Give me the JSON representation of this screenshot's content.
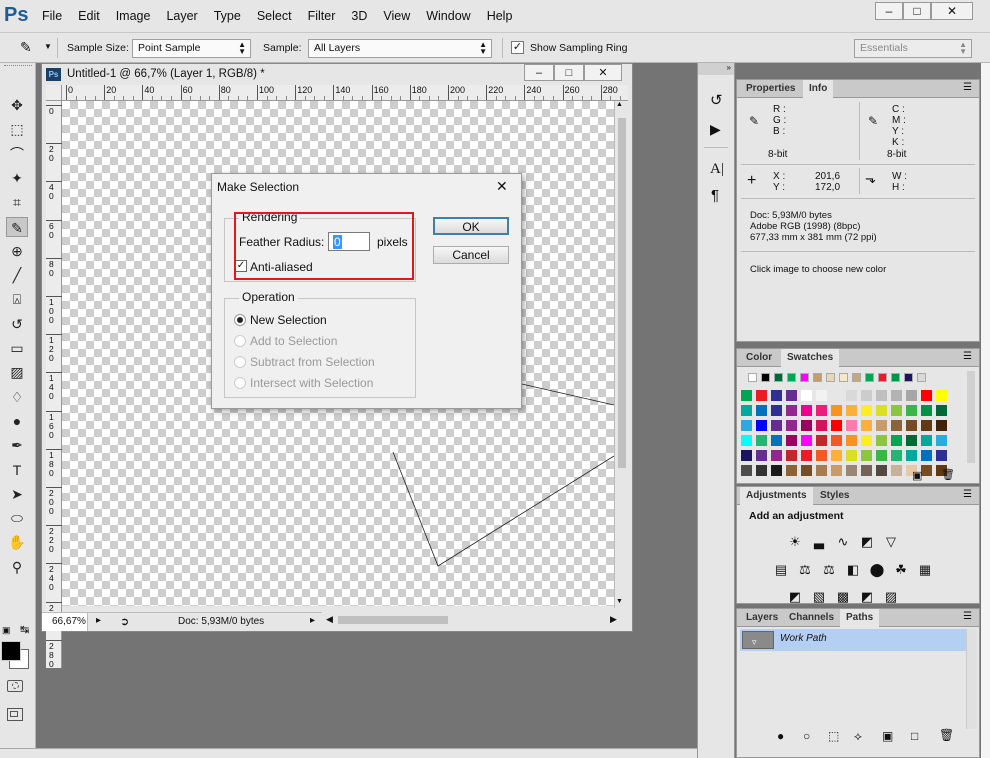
{
  "app": {
    "logo": "Ps",
    "menu": [
      "File",
      "Edit",
      "Image",
      "Layer",
      "Type",
      "Select",
      "Filter",
      "3D",
      "View",
      "Window",
      "Help"
    ],
    "window_controls": [
      "–",
      "□",
      "✕"
    ]
  },
  "options": {
    "sample_size_label": "Sample Size:",
    "sample_size_value": "Point Sample",
    "sample_label": "Sample:",
    "sample_value": "All Layers",
    "show_ring_label": "Show Sampling Ring",
    "show_ring_checked": true,
    "workspace": "Essentials"
  },
  "tools": [
    "move-icon",
    "marquee-icon",
    "lasso-icon",
    "quick-select-icon",
    "crop-icon",
    "eyedropper-icon",
    "healing-icon",
    "brush-icon",
    "stamp-icon",
    "history-brush-icon",
    "eraser-icon",
    "gradient-icon",
    "blur-icon",
    "dodge-icon",
    "pen-icon",
    "type-icon",
    "path-select-icon",
    "shape-icon",
    "hand-icon",
    "zoom-icon"
  ],
  "document": {
    "title": "Untitled-1 @ 66,7% (Layer 1, RGB/8) *",
    "zoom": "66,67%",
    "doc_info": "Doc: 5,93M/0 bytes",
    "ruler_h": [
      "0",
      "20",
      "40",
      "60",
      "80",
      "100",
      "120",
      "140",
      "160",
      "180",
      "200",
      "220",
      "240",
      "260",
      "280"
    ],
    "ruler_v": [
      "0",
      "2\n0",
      "4\n0",
      "6\n0",
      "8\n0",
      "1\n0\n0",
      "1\n2\n0",
      "1\n4\n0",
      "1\n6\n0",
      "1\n8\n0",
      "2\n0\n0",
      "2\n2\n0",
      "2\n4\n0",
      "2\n6\n0",
      "2\n8\n0"
    ]
  },
  "dialog": {
    "title": "Make Selection",
    "close": "✕",
    "rendering": {
      "legend": "Rendering",
      "feather_label": "Feather Radius:",
      "feather_value": "0",
      "feather_unit": "pixels",
      "anti_aliased_label": "Anti-aliased",
      "anti_aliased_checked": true
    },
    "operation": {
      "legend": "Operation",
      "options": [
        {
          "label": "New Selection",
          "selected": true,
          "enabled": true
        },
        {
          "label": "Add to Selection",
          "selected": false,
          "enabled": false
        },
        {
          "label": "Subtract from Selection",
          "selected": false,
          "enabled": false
        },
        {
          "label": "Intersect with Selection",
          "selected": false,
          "enabled": false
        }
      ]
    },
    "ok": "OK",
    "cancel": "Cancel",
    "highlight_color": "#e0191b"
  },
  "info_panel": {
    "tabs": [
      "Properties",
      "Info"
    ],
    "active": "Info",
    "rgb": [
      "R :",
      "G :",
      "B :"
    ],
    "cmyk": [
      "C :",
      "M :",
      "Y :",
      "K :"
    ],
    "bit_left": "8-bit",
    "bit_right": "8-bit",
    "x_label": "X :",
    "y_label": "Y :",
    "x_value": "201,6",
    "y_value": "172,0",
    "w_label": "W :",
    "h_label": "H :",
    "doc": "Doc: 5,93M/0 bytes",
    "profile": "Adobe RGB (1998) (8bpc)",
    "dims": "677,33 mm x 381 mm (72 ppi)",
    "hint": "Click image to choose new color"
  },
  "swatch_panel": {
    "tabs": [
      "Color",
      "Swatches"
    ],
    "active": "Swatches",
    "row0": [
      "#ffffff",
      "#000000",
      "#006837",
      "#00a651",
      "#ff00ff",
      "#c69c6d",
      "#e8d7b5",
      "#f7e7c9",
      "#c8a878",
      "#00a651",
      "#ed1c24",
      "#009245",
      "#1b1464",
      "#d9d9d9"
    ],
    "grid": [
      [
        "#00a651",
        "#ed1c24",
        "#2e3192",
        "#662d91",
        "#ffffff",
        "#f2f2f2",
        "#e6e6e6",
        "#d9d9d9",
        "#cccccc",
        "#bfbfbf",
        "#b3b3b3",
        "#a6a6a6",
        "#ff0000",
        "#ffff00"
      ],
      [
        "#00a99d",
        "#0071bc",
        "#2e3192",
        "#92278f",
        "#ec008c",
        "#ed1e79",
        "#f7931e",
        "#fbb03b",
        "#fcee21",
        "#d9e021",
        "#8cc63f",
        "#39b54a",
        "#009245",
        "#006837"
      ],
      [
        "#29abe2",
        "#0000ff",
        "#662d91",
        "#93278f",
        "#9e005d",
        "#d4145a",
        "#ff0000",
        "#ff7bac",
        "#fbb03b",
        "#c69c6d",
        "#8c6239",
        "#754c24",
        "#603813",
        "#42210b"
      ],
      [
        "#00ffff",
        "#22b573",
        "#0071bc",
        "#9e005d",
        "#ff00ff",
        "#c1272d",
        "#f15a24",
        "#f7931e",
        "#fcee21",
        "#8cc63f",
        "#00a651",
        "#006837",
        "#00a99d",
        "#29abe2"
      ],
      [
        "#1b1464",
        "#662d91",
        "#93278f",
        "#c1272d",
        "#ed1c24",
        "#f15a24",
        "#fbb03b",
        "#d9e021",
        "#8cc63f",
        "#39b54a",
        "#22b573",
        "#00a99d",
        "#0071bc",
        "#2e3192"
      ],
      [
        "#4d4d4d",
        "#333333",
        "#1a1a1a",
        "#8c6239",
        "#754c24",
        "#a67c52",
        "#c69c6d",
        "#998675",
        "#736357",
        "#534741",
        "#c7b299",
        "#e6c9a8",
        "#754c24",
        "#603813"
      ]
    ]
  },
  "adjustments": {
    "tabs": [
      "Adjustments",
      "Styles"
    ],
    "active": "Adjustments",
    "heading": "Add an adjustment",
    "row1": [
      "brightness-icon",
      "levels-icon",
      "curves-icon",
      "exposure-icon",
      "gradient-map-icon"
    ],
    "row2": [
      "vibrance-icon",
      "hue-icon",
      "color-balance-icon",
      "black-white-icon",
      "photo-filter-icon",
      "mixer-icon",
      "lookup-icon"
    ],
    "row3": [
      "invert-icon",
      "posterize-icon",
      "threshold-icon",
      "selective-color-icon",
      "gradient-fill-icon"
    ]
  },
  "paths_panel": {
    "tabs": [
      "Layers",
      "Channels",
      "Paths"
    ],
    "active": "Paths",
    "item": "Work Path"
  }
}
